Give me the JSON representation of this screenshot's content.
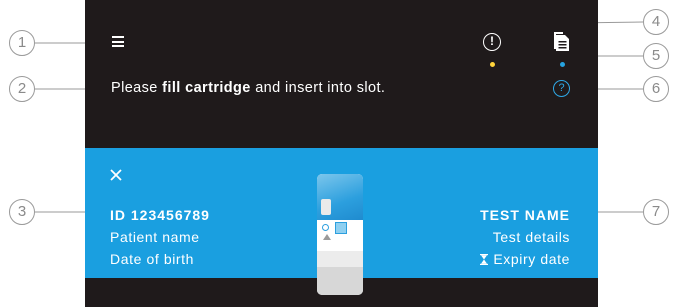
{
  "callouts": [
    "1",
    "2",
    "3",
    "4",
    "5",
    "6",
    "7"
  ],
  "header": {
    "menu_icon": "hamburger-menu-icon",
    "alert_icon": "alert-circle-icon",
    "alert_glyph": "!",
    "alert_dot_color": "#ffd43b",
    "document_icon": "document-icon",
    "document_dot_color": "#26a3e0",
    "help_icon": "help-circle-icon",
    "help_glyph": "?"
  },
  "instruction": {
    "before": "Please ",
    "bold": "fill cartridge",
    "after": " and insert into slot."
  },
  "panel": {
    "background": "#1a9fe0",
    "close_icon": "close-icon",
    "patient": {
      "id": "ID 123456789",
      "name": "Patient name",
      "dob": "Date of birth"
    },
    "test": {
      "name": "TEST NAME",
      "details": "Test details",
      "expiry": "Expiry date",
      "expiry_icon": "hourglass-icon"
    },
    "cartridge_icon": "cartridge-illustration"
  },
  "colors": {
    "screen_bg": "#1f1a1b",
    "accent_blue": "#1a9fe0"
  }
}
